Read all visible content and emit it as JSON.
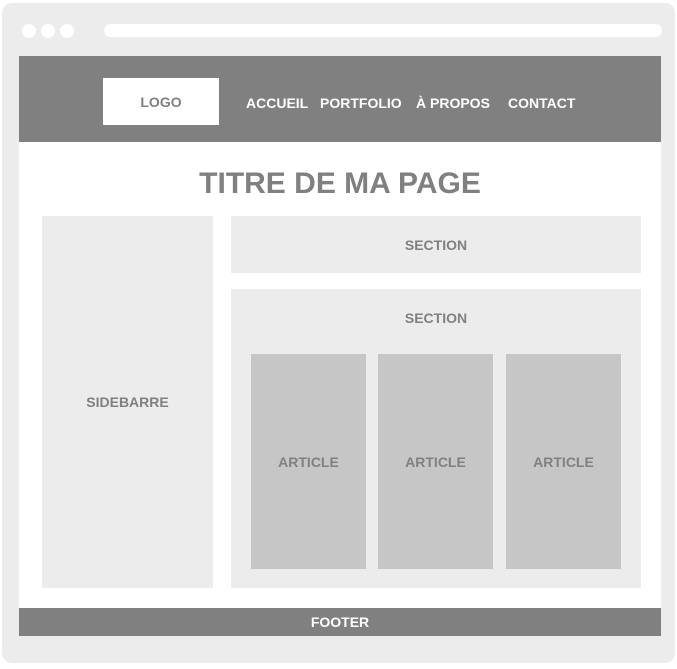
{
  "header": {
    "logo_label": "LOGO",
    "nav": [
      "ACCUEIL",
      "PORTFOLIO",
      "À PROPOS",
      "CONTACT"
    ]
  },
  "main": {
    "title": "TITRE DE MA PAGE",
    "sidebar_label": "SIDEBARRE",
    "section_top_label": "SECTION",
    "section_bottom_label": "SECTION",
    "articles": [
      "ARTICLE",
      "ARTICLE",
      "ARTICLE"
    ]
  },
  "footer": {
    "label": "FOOTER"
  },
  "colors": {
    "dark_gray": "#808080",
    "light_gray": "#ececec",
    "article_gray": "#c6c6c6",
    "white": "#ffffff"
  }
}
